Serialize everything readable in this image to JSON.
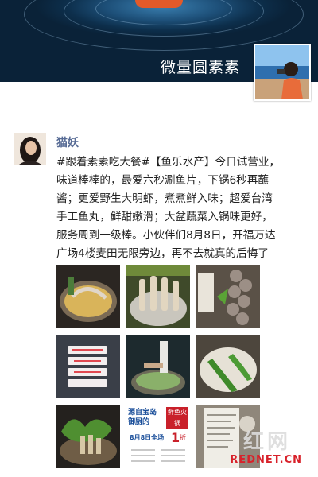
{
  "profile": {
    "name": "微量圆素素"
  },
  "post": {
    "author": "猫妖",
    "lines": [
      "#跟着素素吃大餐#【鱼乐水产】今日试营业，",
      "味道棒棒的，最爱六秒涮鱼片，下锅6秒再蘸",
      "酱；更爱野生大明虾，煮煮鲜入味；超爱台湾",
      "手工鱼丸，鲜甜嫩滑；大盆蔬菜入锅味更好，",
      "服务周到一级棒。小伙伴们8月8日，开福万达",
      "广场4楼麦田无限旁边，再不去就真的后悔了"
    ],
    "emoji": "cool-sunglasses-emoji"
  },
  "photos": {
    "promo_title": "源自宝岛 御厨的",
    "promo_badge": "鲜鱼火锅",
    "promo_date": "8月8日全场",
    "promo_discount": "1",
    "promo_unit": "折"
  },
  "watermark": {
    "cn": "红网",
    "en": "REDNET.CN"
  }
}
